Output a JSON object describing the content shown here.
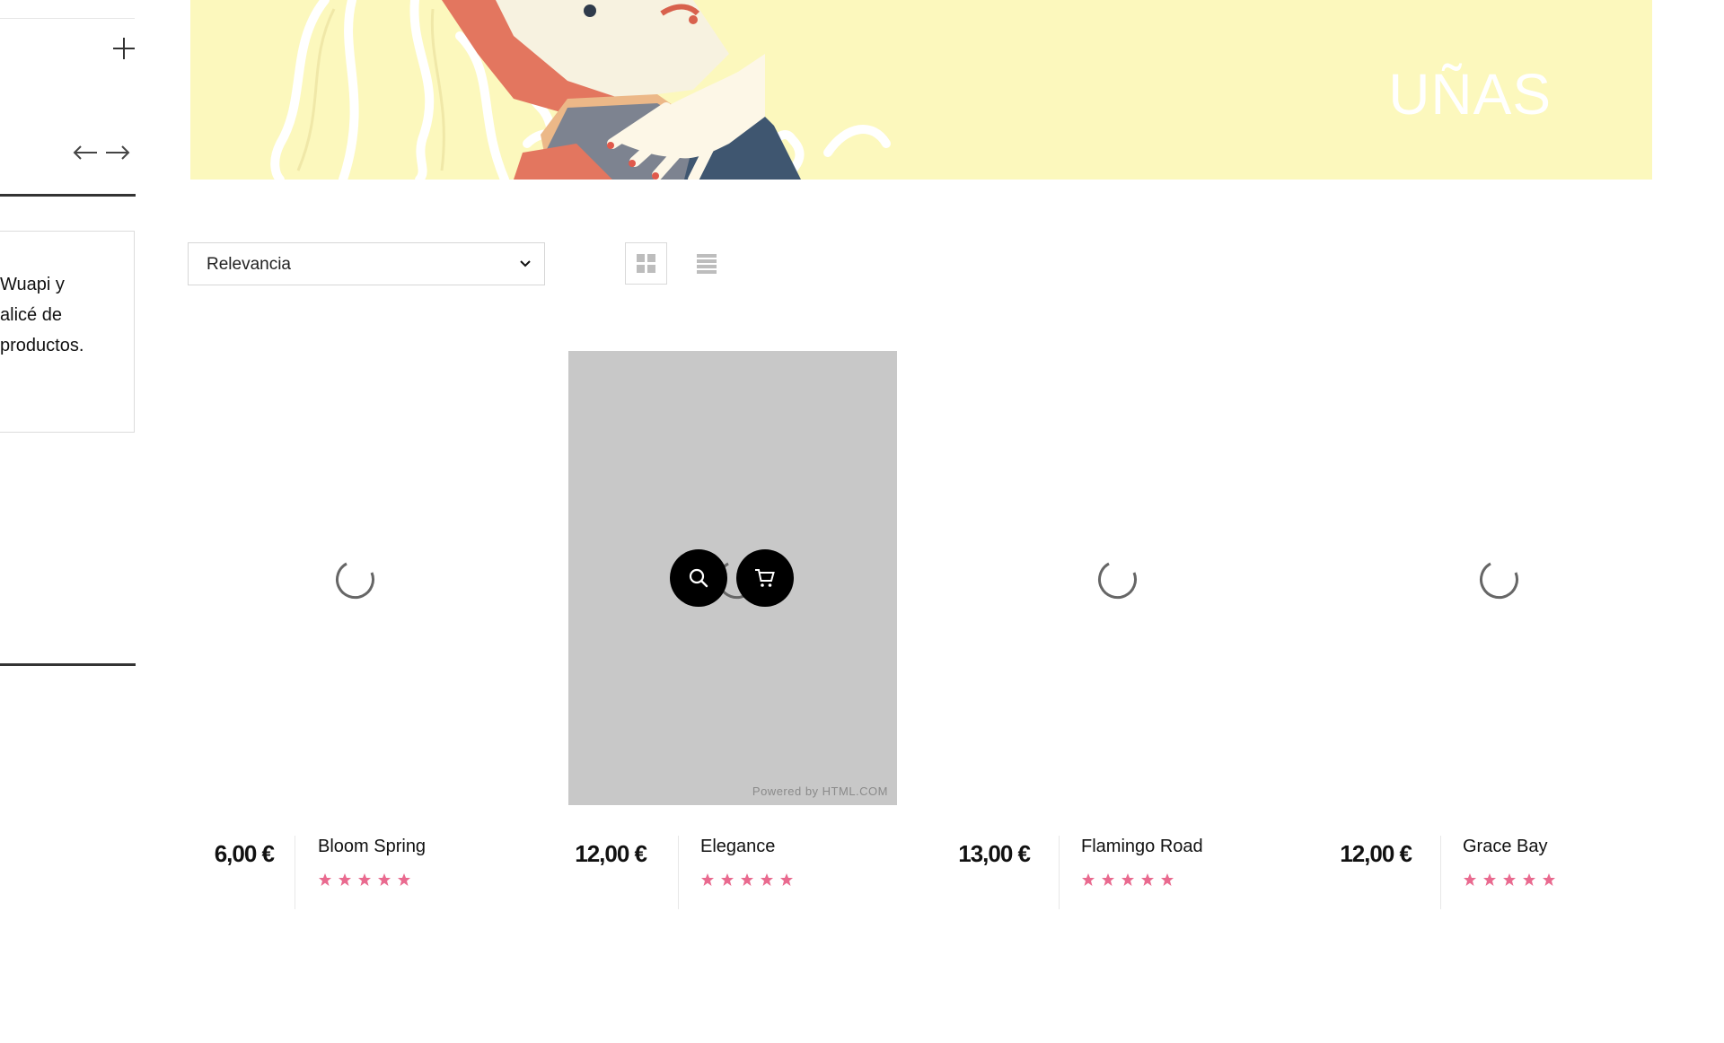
{
  "sidebar": {
    "text_lines": [
      "Wuapi y",
      "alicé de",
      "productos."
    ]
  },
  "banner": {
    "title": "UÑAS"
  },
  "toolbar": {
    "sort_selected": "Relevancia"
  },
  "products": [
    {
      "price": "6,00 €",
      "name": "Bloom Spring",
      "rating": 5,
      "state": "loading"
    },
    {
      "price": "12,00 €",
      "name": "Elegance",
      "rating": 5,
      "state": "hover",
      "image_caption": "Powered by HTML.COM"
    },
    {
      "price": "13,00 €",
      "name": "Flamingo Road",
      "rating": 5,
      "state": "loading"
    },
    {
      "price": "12,00 €",
      "name": "Grace Bay",
      "rating": 5,
      "state": "loading"
    }
  ],
  "colors": {
    "banner_bg": "#fcf8bd",
    "star": "#e96a8f",
    "hover_overlay": "#c8c8c8"
  }
}
